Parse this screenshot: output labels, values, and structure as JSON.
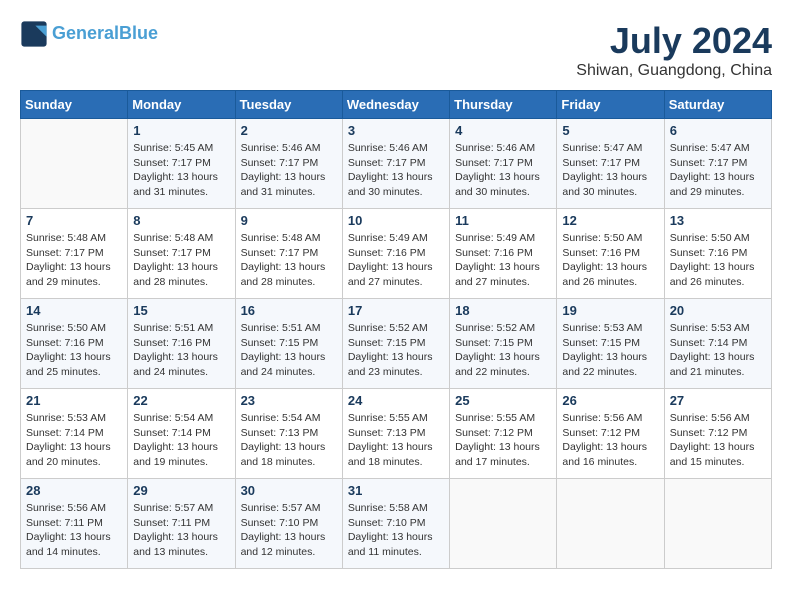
{
  "header": {
    "logo_line1": "General",
    "logo_line2": "Blue",
    "month_year": "July 2024",
    "location": "Shiwan, Guangdong, China"
  },
  "weekdays": [
    "Sunday",
    "Monday",
    "Tuesday",
    "Wednesday",
    "Thursday",
    "Friday",
    "Saturday"
  ],
  "weeks": [
    [
      {
        "day": "",
        "detail": ""
      },
      {
        "day": "1",
        "detail": "Sunrise: 5:45 AM\nSunset: 7:17 PM\nDaylight: 13 hours\nand 31 minutes."
      },
      {
        "day": "2",
        "detail": "Sunrise: 5:46 AM\nSunset: 7:17 PM\nDaylight: 13 hours\nand 31 minutes."
      },
      {
        "day": "3",
        "detail": "Sunrise: 5:46 AM\nSunset: 7:17 PM\nDaylight: 13 hours\nand 30 minutes."
      },
      {
        "day": "4",
        "detail": "Sunrise: 5:46 AM\nSunset: 7:17 PM\nDaylight: 13 hours\nand 30 minutes."
      },
      {
        "day": "5",
        "detail": "Sunrise: 5:47 AM\nSunset: 7:17 PM\nDaylight: 13 hours\nand 30 minutes."
      },
      {
        "day": "6",
        "detail": "Sunrise: 5:47 AM\nSunset: 7:17 PM\nDaylight: 13 hours\nand 29 minutes."
      }
    ],
    [
      {
        "day": "7",
        "detail": "Sunrise: 5:48 AM\nSunset: 7:17 PM\nDaylight: 13 hours\nand 29 minutes."
      },
      {
        "day": "8",
        "detail": "Sunrise: 5:48 AM\nSunset: 7:17 PM\nDaylight: 13 hours\nand 28 minutes."
      },
      {
        "day": "9",
        "detail": "Sunrise: 5:48 AM\nSunset: 7:17 PM\nDaylight: 13 hours\nand 28 minutes."
      },
      {
        "day": "10",
        "detail": "Sunrise: 5:49 AM\nSunset: 7:16 PM\nDaylight: 13 hours\nand 27 minutes."
      },
      {
        "day": "11",
        "detail": "Sunrise: 5:49 AM\nSunset: 7:16 PM\nDaylight: 13 hours\nand 27 minutes."
      },
      {
        "day": "12",
        "detail": "Sunrise: 5:50 AM\nSunset: 7:16 PM\nDaylight: 13 hours\nand 26 minutes."
      },
      {
        "day": "13",
        "detail": "Sunrise: 5:50 AM\nSunset: 7:16 PM\nDaylight: 13 hours\nand 26 minutes."
      }
    ],
    [
      {
        "day": "14",
        "detail": "Sunrise: 5:50 AM\nSunset: 7:16 PM\nDaylight: 13 hours\nand 25 minutes."
      },
      {
        "day": "15",
        "detail": "Sunrise: 5:51 AM\nSunset: 7:16 PM\nDaylight: 13 hours\nand 24 minutes."
      },
      {
        "day": "16",
        "detail": "Sunrise: 5:51 AM\nSunset: 7:15 PM\nDaylight: 13 hours\nand 24 minutes."
      },
      {
        "day": "17",
        "detail": "Sunrise: 5:52 AM\nSunset: 7:15 PM\nDaylight: 13 hours\nand 23 minutes."
      },
      {
        "day": "18",
        "detail": "Sunrise: 5:52 AM\nSunset: 7:15 PM\nDaylight: 13 hours\nand 22 minutes."
      },
      {
        "day": "19",
        "detail": "Sunrise: 5:53 AM\nSunset: 7:15 PM\nDaylight: 13 hours\nand 22 minutes."
      },
      {
        "day": "20",
        "detail": "Sunrise: 5:53 AM\nSunset: 7:14 PM\nDaylight: 13 hours\nand 21 minutes."
      }
    ],
    [
      {
        "day": "21",
        "detail": "Sunrise: 5:53 AM\nSunset: 7:14 PM\nDaylight: 13 hours\nand 20 minutes."
      },
      {
        "day": "22",
        "detail": "Sunrise: 5:54 AM\nSunset: 7:14 PM\nDaylight: 13 hours\nand 19 minutes."
      },
      {
        "day": "23",
        "detail": "Sunrise: 5:54 AM\nSunset: 7:13 PM\nDaylight: 13 hours\nand 18 minutes."
      },
      {
        "day": "24",
        "detail": "Sunrise: 5:55 AM\nSunset: 7:13 PM\nDaylight: 13 hours\nand 18 minutes."
      },
      {
        "day": "25",
        "detail": "Sunrise: 5:55 AM\nSunset: 7:12 PM\nDaylight: 13 hours\nand 17 minutes."
      },
      {
        "day": "26",
        "detail": "Sunrise: 5:56 AM\nSunset: 7:12 PM\nDaylight: 13 hours\nand 16 minutes."
      },
      {
        "day": "27",
        "detail": "Sunrise: 5:56 AM\nSunset: 7:12 PM\nDaylight: 13 hours\nand 15 minutes."
      }
    ],
    [
      {
        "day": "28",
        "detail": "Sunrise: 5:56 AM\nSunset: 7:11 PM\nDaylight: 13 hours\nand 14 minutes."
      },
      {
        "day": "29",
        "detail": "Sunrise: 5:57 AM\nSunset: 7:11 PM\nDaylight: 13 hours\nand 13 minutes."
      },
      {
        "day": "30",
        "detail": "Sunrise: 5:57 AM\nSunset: 7:10 PM\nDaylight: 13 hours\nand 12 minutes."
      },
      {
        "day": "31",
        "detail": "Sunrise: 5:58 AM\nSunset: 7:10 PM\nDaylight: 13 hours\nand 11 minutes."
      },
      {
        "day": "",
        "detail": ""
      },
      {
        "day": "",
        "detail": ""
      },
      {
        "day": "",
        "detail": ""
      }
    ]
  ]
}
